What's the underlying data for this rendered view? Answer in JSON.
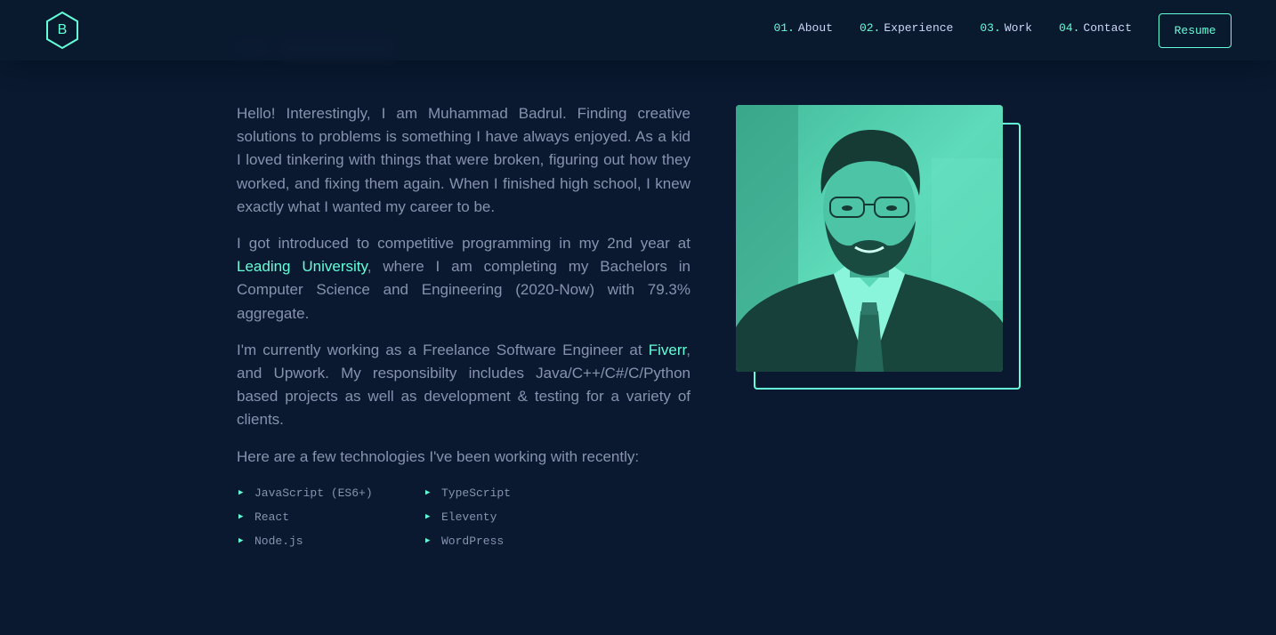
{
  "header": {
    "logo_letter": "B",
    "nav": [
      {
        "num": "01.",
        "label": "About"
      },
      {
        "num": "02.",
        "label": "Experience"
      },
      {
        "num": "03.",
        "label": "Work"
      },
      {
        "num": "04.",
        "label": "Contact"
      }
    ],
    "resume_label": "Resume"
  },
  "about": {
    "p1": "Hello! Interestingly, I am Muhammad Badrul. Finding creative solutions to problems is something I have always enjoyed. As a kid I loved tinkering with things that were broken, figuring out how they worked, and fixing them again. When I finished high school, I knew exactly what I wanted my career to be.",
    "p2_pre": "I got introduced to competitive programming in my 2nd year at ",
    "p2_link": "Leading University",
    "p2_post": ", where I am completing my Bachelors in Computer Science and Engineering (2020-Now) with 79.3% aggregate.",
    "p3_pre": "I'm currently working as a Freelance Software Engineer at ",
    "p3_link": "Fiverr",
    "p3_post": ", and Upwork. My responsibilty includes Java/C++/C#/C/Python based projects as well as development & testing for a variety of clients.",
    "p4": "Here are a few technologies I've been working with recently:",
    "skills": [
      "JavaScript (ES6+)",
      "TypeScript",
      "React",
      "Eleventy",
      "Node.js",
      "WordPress"
    ]
  },
  "colors": {
    "background": "#0a192f",
    "accent": "#64ffda",
    "text": "#8892b0",
    "heading": "#ccd6f6"
  }
}
